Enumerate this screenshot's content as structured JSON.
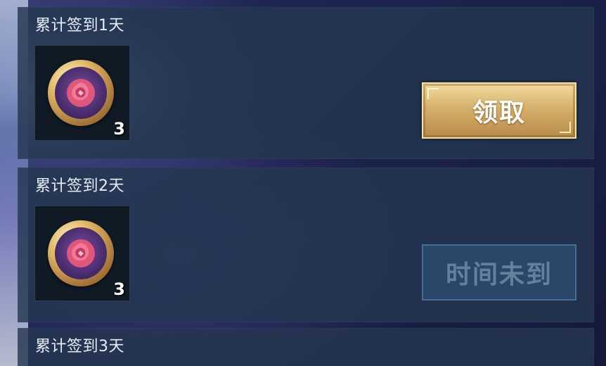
{
  "rows": [
    {
      "title": "累计签到1天",
      "reward": {
        "icon": "rose-coin-icon",
        "count": "3"
      },
      "button": {
        "label": "领取",
        "state": "claimable"
      }
    },
    {
      "title": "累计签到2天",
      "reward": {
        "icon": "rose-coin-icon",
        "count": "3"
      },
      "button": {
        "label": "时间未到",
        "state": "locked"
      }
    },
    {
      "title": "累计签到3天"
    }
  ],
  "colors": {
    "panel": "#243750",
    "claim_gold": "#d6b06a",
    "locked_blue": "#325a82",
    "text": "#e7edf5"
  }
}
